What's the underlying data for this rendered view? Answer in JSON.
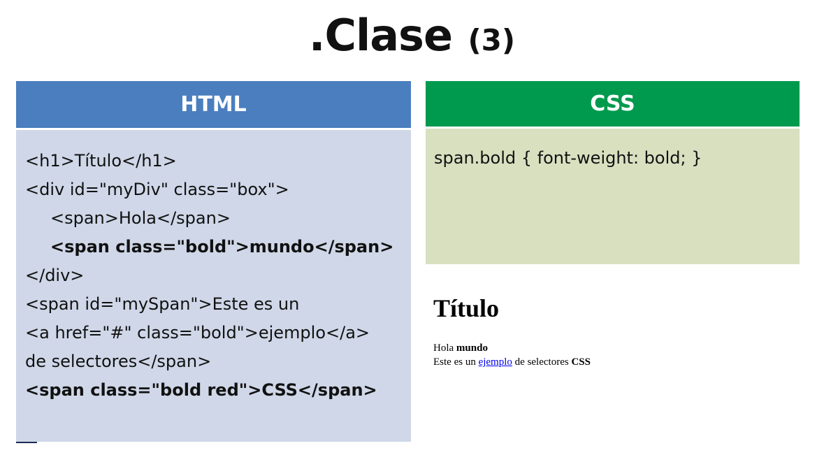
{
  "title": {
    "main": ".Clase",
    "number": "(3)"
  },
  "html_panel": {
    "header": "HTML",
    "lines": [
      "<h1>Título</h1>",
      "<div id=\"myDiv\" class=\"box\">",
      "<span>Hola</span>",
      "<span class=\"bold\">mundo</span>",
      "</div>",
      "<span id=\"mySpan\">Este es un",
      "<a href=\"#\" class=\"bold\">ejemplo</a>",
      "de selectores</span>",
      "<span class=\"bold red\">CSS</span>"
    ]
  },
  "css_panel": {
    "header": "CSS",
    "code": "span.bold { font-weight: bold; }"
  },
  "preview": {
    "heading": "Título",
    "hola": "Hola",
    "mundo": "mundo",
    "este_es_un": "Este es un",
    "ejemplo": "ejemplo",
    "de_selectores": "de selectores",
    "css": "CSS"
  },
  "colors": {
    "html_header": "#4a7ebf",
    "html_body": "#cfd7e8",
    "css_header": "#009a4e",
    "css_body": "#d9e0c0",
    "link": "#0000ee"
  }
}
